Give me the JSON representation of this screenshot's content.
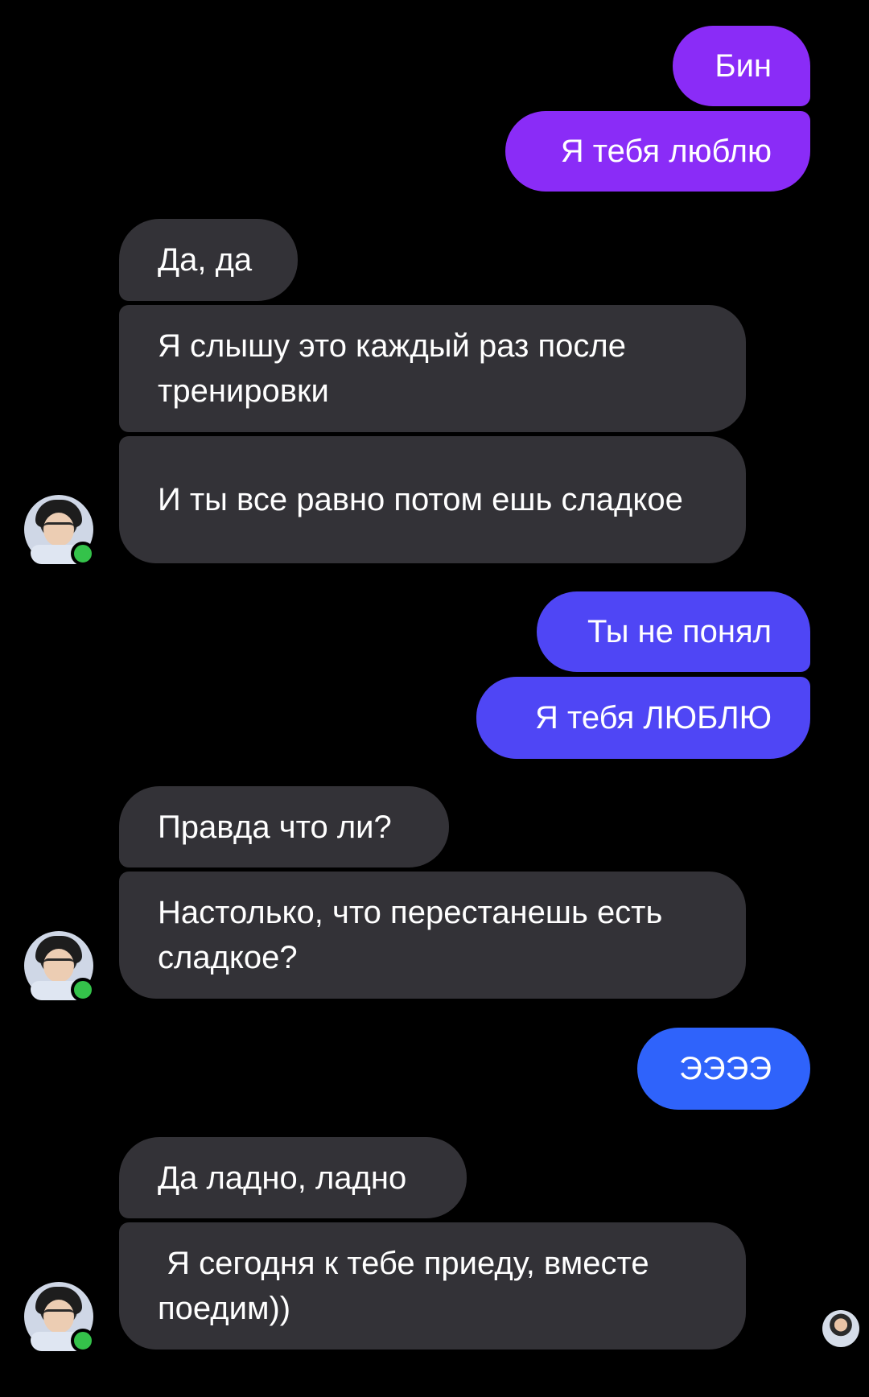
{
  "messages": [
    {
      "side": "out",
      "text": "Бин"
    },
    {
      "side": "out",
      "text": "Я тебя люблю"
    },
    {
      "side": "in",
      "text": "Да, да"
    },
    {
      "side": "in",
      "text": "Я слышу это каждый раз после тренировки"
    },
    {
      "side": "in",
      "text": "И ты все равно потом ешь сладкое"
    },
    {
      "side": "out",
      "text": "Ты не понял"
    },
    {
      "side": "out",
      "text": "Я тебя ЛЮБЛЮ"
    },
    {
      "side": "in",
      "text": "Правда что ли?"
    },
    {
      "side": "in",
      "text": "Настолько, что перестанешь есть сладкое?"
    },
    {
      "side": "out",
      "text": "ЭЭЭЭ"
    },
    {
      "side": "in",
      "text": "Да ладно, ладно"
    },
    {
      "side": "in",
      "text": " Я сегодня к тебе приеду, вместе поедим))"
    }
  ],
  "colors": {
    "background": "#000000",
    "incoming_bubble": "#333237",
    "outgoing_purple": "#8a2cf7",
    "outgoing_indigo": "#4f46f5",
    "outgoing_blue": "#2f63fb",
    "online_status": "#34c24a"
  },
  "icons": {
    "avatar": "contact-avatar-photo",
    "status": "online-status-dot",
    "seen": "seen-receipt-avatar"
  }
}
